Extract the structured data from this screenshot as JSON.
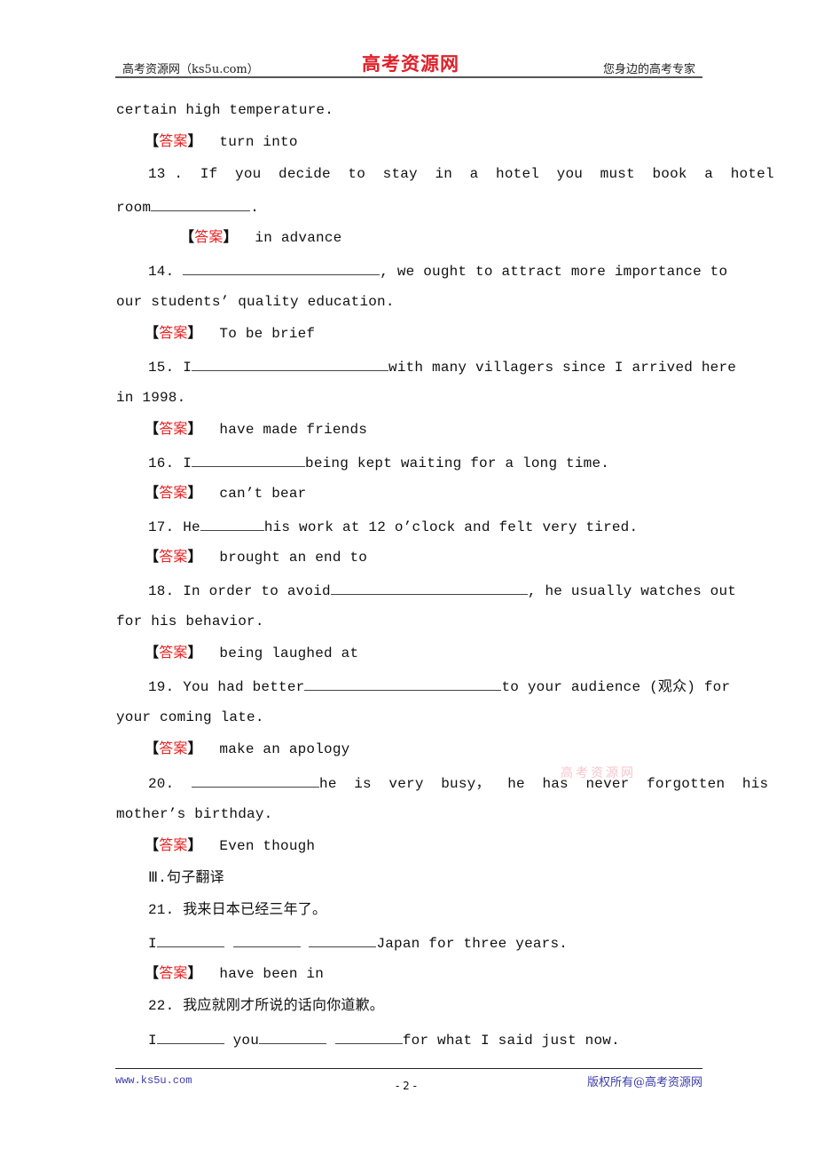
{
  "header": {
    "left": "高考资源网（ks5u.com）",
    "logo": "高考资源网",
    "right": "您身边的高考专家"
  },
  "answer_tag": {
    "open": "【",
    "label": "答案",
    "close": "】"
  },
  "lines": {
    "l01": "certain high temperature.",
    "a12": "turn into",
    "q13a": "13 .  If  you  decide  to  stay  in  a  hotel  you  must  book  a  hotel",
    "q13b_pre": "room",
    "q13b_post": ".",
    "a13": "in advance",
    "q14a_pre": "14. ",
    "q14a_post": ", we ought to attract more importance to",
    "q14b": "our students’ quality education.",
    "a14": "To be brief",
    "q15a_pre": "15. I",
    "q15a_post": "with many villagers since I arrived here",
    "q15b": "in 1998.",
    "a15": "have made friends",
    "q16_pre": "16. I",
    "q16_post": "being kept waiting for a long time.",
    "a16": "can’t bear",
    "q17_pre": "17. He",
    "q17_post": "his work at 12 o’clock and felt very tired.",
    "a17": "brought an end to",
    "q18a_pre": "18. In order to avoid",
    "q18a_post": ", he usually watches out",
    "q18b": "for his behavior.",
    "a18": "being laughed at",
    "q19a_pre": "19. You had better",
    "q19a_post": "to your audience (观众) for",
    "q19b": "your coming late.",
    "a19": "make an apology",
    "q20a_pre": "20.  ",
    "q20a_post": "he  is  very  busy，  he  has  never  forgotten  his",
    "q20b": "mother’s birthday.",
    "a20": "Even though",
    "section3": "Ⅲ.句子翻译",
    "q21": "21. 我来日本已经三年了。",
    "q21e_pre": "I",
    "q21e_post": "Japan for three years.",
    "a21": "have been in",
    "q22": "22. 我应就刚才所说的话向你道歉。",
    "q22e_pre": "I",
    "q22e_mid": " you",
    "q22e_post": "for what I said just now."
  },
  "watermark": "高考资源网",
  "footer": {
    "left": "www.ks5u.com",
    "page": "- 2 -",
    "right": "版权所有@高考资源网"
  }
}
